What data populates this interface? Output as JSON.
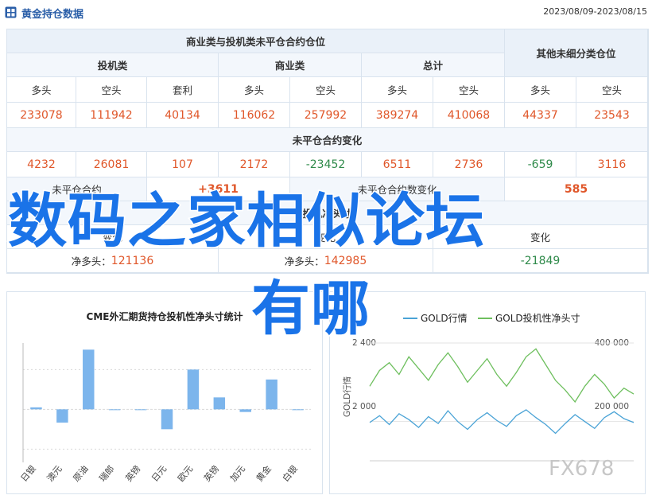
{
  "header": {
    "title": "黄金持仓数据",
    "date_range": "2023/08/09-2023/08/15"
  },
  "table": {
    "group_left": "商业类与投机类未平仓合约仓位",
    "group_right": "其他未细分类仓位",
    "cat_spec": "投机类",
    "cat_comm": "商业类",
    "cat_total": "总计",
    "col_long": "多头",
    "col_short": "空头",
    "col_spread": "套利",
    "values": {
      "spec_long": "233078",
      "spec_short": "111942",
      "spec_spread": "40134",
      "comm_long": "116062",
      "comm_short": "257992",
      "total_long": "389274",
      "total_short": "410068",
      "other_long": "44337",
      "other_short": "23543"
    },
    "change_title": "未平仓合约变化",
    "changes": {
      "spec_long": "4232",
      "spec_short": "26081",
      "spec_spread": "107",
      "comm_long": "2172",
      "comm_short": "-23452",
      "total_long": "6511",
      "total_short": "2736",
      "other_long": "-659",
      "other_short": "3116"
    },
    "oi_label": "未平仓合约",
    "oi_value": "+3611",
    "oi_change_label": "未平仓合约数变化",
    "oi_change_value": "585",
    "net_title": "投机净头寸",
    "net_left_label": "变化",
    "net_mid_label": "变化",
    "net_right_label": "变化",
    "net_long_prefix": "净多头：",
    "net_long_value": "121136",
    "net_long2_prefix": "净多头：",
    "net_long2_value": "142985",
    "net_right_value": "-21849"
  },
  "cme_chart": {
    "title": "CME外汇期货持仓投机性净头寸统计"
  },
  "gold_chart": {
    "legend_a": "GOLD行情",
    "legend_b": "GOLD投机性净头寸",
    "y_left_top": "2 400",
    "y_left_mid": "2 000",
    "y_right_top": "400 000",
    "y_right_mid": "200 000",
    "y_left_label": "GOLD行情"
  },
  "colors": {
    "bar": "#7cb5ec",
    "line_price": "#4aa3d6",
    "line_net": "#6ebf5e",
    "num_up": "#e0572a",
    "num_down": "#2f8a4a",
    "header": "#2a5ea8"
  },
  "chart_data": [
    {
      "type": "bar",
      "title": "CME外汇期货持仓投机性净头寸统计",
      "categories": [
        "日银",
        "澳元",
        "原油",
        "瑞郎",
        "英镑",
        "日元",
        "欧元",
        "英镑",
        "加元",
        "黄金",
        "白银"
      ],
      "values": [
        0.3,
        -2.0,
        9.0,
        -0.1,
        0.0,
        -3.0,
        6.0,
        1.8,
        -0.4,
        4.5,
        0.0
      ],
      "ylim": [
        -8,
        10
      ],
      "grid": true
    },
    {
      "type": "line",
      "series": [
        {
          "name": "GOLD行情",
          "values": [
            1995,
            2030,
            1985,
            2040,
            2010,
            1970,
            2025,
            1990,
            2055,
            2000,
            1960,
            2010,
            2045,
            2005,
            1975,
            2030,
            2060,
            2020,
            1985,
            1940,
            1990,
            2035,
            2000,
            1965,
            2020,
            2050,
            2015,
            1995
          ]
        },
        {
          "name": "GOLD投机性净头寸",
          "values": [
            2180,
            2260,
            2300,
            2240,
            2330,
            2270,
            2210,
            2290,
            2350,
            2280,
            2200,
            2260,
            2320,
            2240,
            2180,
            2250,
            2330,
            2370,
            2290,
            2210,
            2160,
            2100,
            2180,
            2240,
            2190,
            2120,
            2170,
            2140
          ]
        }
      ],
      "ylim": [
        1800,
        2400
      ],
      "grid": true
    }
  ],
  "watermark": {
    "line1": "数码之家相似论坛",
    "line2": "有哪",
    "corner": "FX678"
  }
}
